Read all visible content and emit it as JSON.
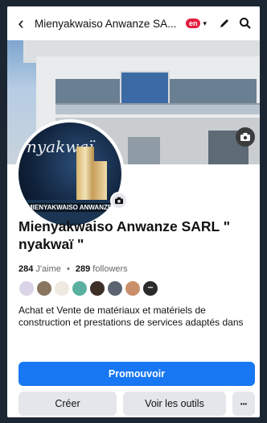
{
  "topbar": {
    "title": "Mienyakwaiso Anwanze SA...",
    "badge": "en",
    "back_glyph": "‹",
    "caret_glyph": "▾",
    "icons": [
      "back-chevron-icon",
      "pencil-icon",
      "search-icon"
    ]
  },
  "cover": {
    "camera_icon": "camera-icon"
  },
  "avatar": {
    "logo_text": "nyakwaï",
    "ribbon_text": "MIENYAKWAISO ANWANZE",
    "camera_icon": "camera-icon"
  },
  "page": {
    "name": "Mienyakwaiso Anwanze SARL \" nyakwaï \"",
    "likes_count": "284",
    "likes_label": "J'aime",
    "separator": "•",
    "followers_count": "289",
    "followers_label": "followers",
    "friends_more_glyph": "•••",
    "bio": "Achat et Vente de matériaux et matériels de construction et prestations de services adaptés dans"
  },
  "actions": {
    "promote": "Promouvoir",
    "create": "Créer",
    "tools": "Voir les outils",
    "more": "•••"
  },
  "colors": {
    "primary": "#1877f2",
    "secondary_button": "#e4e6eb",
    "badge": "#e41e3f",
    "background": "#1c2633"
  }
}
